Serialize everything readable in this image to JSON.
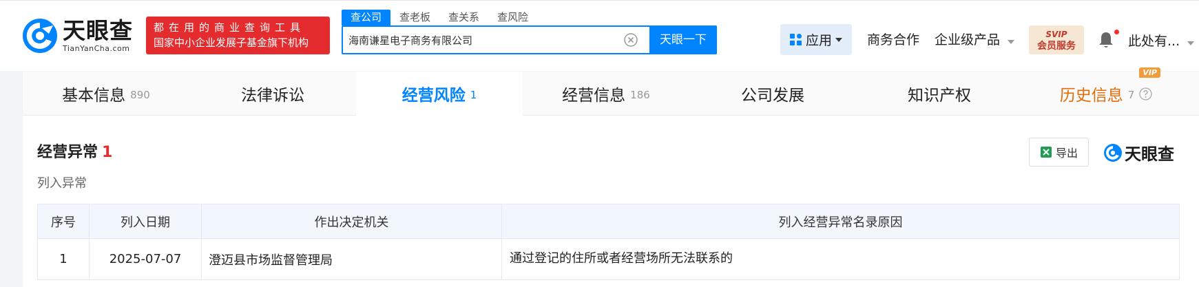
{
  "header": {
    "logo_cn": "天眼查",
    "logo_en": "TianYanCha.com",
    "slogan_line1": "都在用的商业查询工具",
    "slogan_line2": "国家中小企业发展子基金旗下机构",
    "search_tabs": [
      "查公司",
      "查老板",
      "查关系",
      "查风险"
    ],
    "search_value": "海南谦星电子商务有限公司",
    "search_button": "天眼一下",
    "app_label": "应用",
    "nav_business": "商务合作",
    "nav_enterprise": "企业级产品",
    "svip_top": "SVIP",
    "svip_bottom": "会员服务",
    "user_label": "此处有..."
  },
  "tabs": [
    {
      "label": "基本信息",
      "count": "890"
    },
    {
      "label": "法律诉讼",
      "count": ""
    },
    {
      "label": "经营风险",
      "count": "1"
    },
    {
      "label": "经营信息",
      "count": "186"
    },
    {
      "label": "公司发展",
      "count": ""
    },
    {
      "label": "知识产权",
      "count": ""
    },
    {
      "label": "历史信息",
      "count": "7"
    }
  ],
  "vip_badge": "VIP",
  "section": {
    "title": "经营异常",
    "count": "1",
    "subtitle": "列入异常",
    "export_label": "导出",
    "brand": "天眼查"
  },
  "table": {
    "headers": [
      "序号",
      "列入日期",
      "作出决定机关",
      "列入经营异常名录原因"
    ],
    "rows": [
      [
        "1",
        "2025-07-07",
        "澄迈县市场监督管理局",
        "通过登记的住所或者经营场所无法联系的"
      ]
    ]
  },
  "colors": {
    "accent": "#0084ff",
    "slogan_bg": "#e42c2f",
    "history": "#e36c09"
  }
}
